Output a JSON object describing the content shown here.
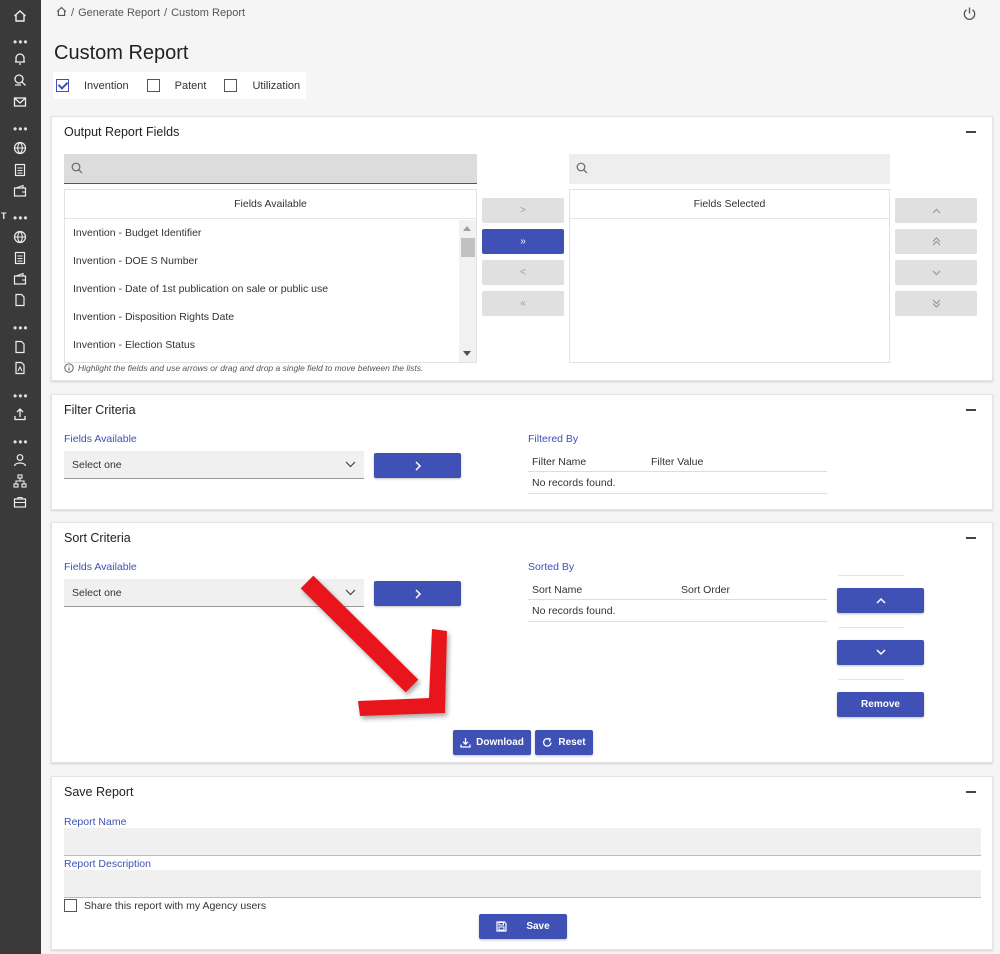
{
  "breadcrumb": {
    "items": [
      "Generate Report",
      "Custom Report"
    ],
    "separator": "/"
  },
  "page": {
    "title": "Custom Report"
  },
  "report_types": [
    {
      "label": "Invention",
      "checked": true
    },
    {
      "label": "Patent",
      "checked": false
    },
    {
      "label": "Utilization",
      "checked": false
    }
  ],
  "output_fields": {
    "title": "Output Report Fields",
    "available_header": "Fields Available",
    "selected_header": "Fields Selected",
    "available_items": [
      "Invention - Budget Identifier",
      "Invention - DOE S Number",
      "Invention - Date of 1st publication on sale or public use",
      "Invention - Disposition Rights Date",
      "Invention - Election Status"
    ],
    "transfer_buttons": [
      ">",
      "»",
      "<",
      "«"
    ],
    "order_buttons": [
      "move-up",
      "move-top",
      "move-down",
      "move-bottom"
    ],
    "hint": "Highlight the fields and use arrows or drag and drop a single field to move between the lists."
  },
  "filter": {
    "title": "Filter Criteria",
    "fields_label": "Fields Available",
    "select_value": "Select one",
    "filtered_label": "Filtered By",
    "col_name": "Filter Name",
    "col_value": "Filter Value",
    "empty": "No records found."
  },
  "sort": {
    "title": "Sort Criteria",
    "fields_label": "Fields Available",
    "select_value": "Select one",
    "sorted_label": "Sorted By",
    "col_name": "Sort Name",
    "col_order": "Sort Order",
    "empty": "No records found.",
    "remove_label": "Remove",
    "download_label": "Download",
    "reset_label": "Reset"
  },
  "save": {
    "title": "Save Report",
    "name_label": "Report Name",
    "desc_label": "Report Description",
    "share_label": "Share this report with my Agency users",
    "save_label": "Save"
  },
  "colors": {
    "primary": "#3f51b5",
    "nav": "#3a3a3a",
    "annotation": "#e8141a"
  }
}
